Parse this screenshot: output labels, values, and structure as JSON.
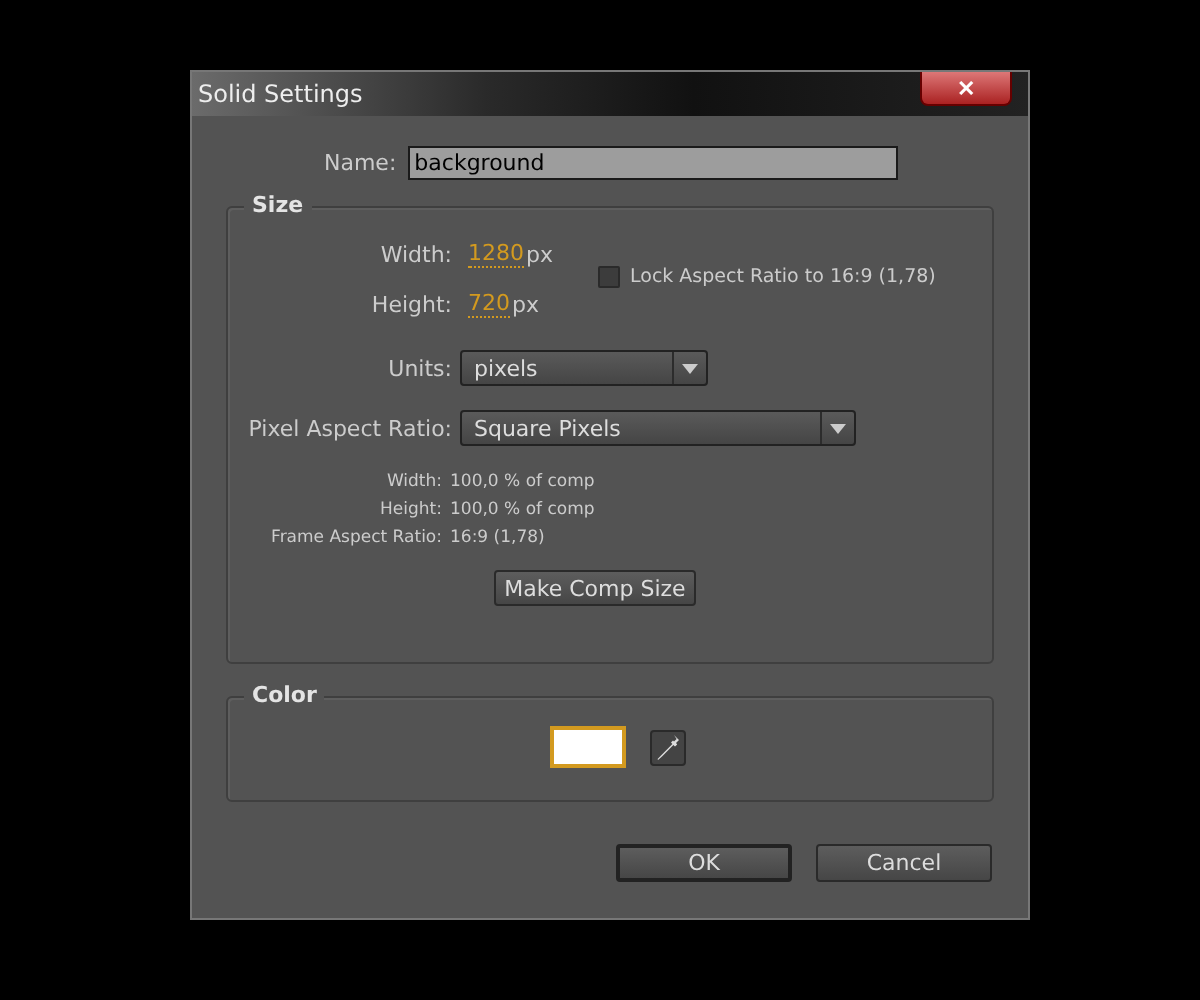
{
  "window": {
    "title": "Solid Settings",
    "close": "✕"
  },
  "name": {
    "label": "Name:",
    "value": "background"
  },
  "size": {
    "title": "Size",
    "width": {
      "label": "Width:",
      "value": "1280",
      "unit": "px"
    },
    "height": {
      "label": "Height:",
      "value": "720",
      "unit": "px"
    },
    "lock": {
      "label": "Lock Aspect Ratio to 16:9 (1,78)",
      "checked": false
    },
    "units": {
      "label": "Units:",
      "value": "pixels"
    },
    "pixel_aspect": {
      "label": "Pixel Aspect Ratio:",
      "value": "Square Pixels"
    },
    "info": [
      {
        "label": "Width:",
        "value": "100,0 % of comp"
      },
      {
        "label": "Height:",
        "value": "100,0 % of comp"
      },
      {
        "label": "Frame Aspect Ratio:",
        "value": "16:9 (1,78)"
      }
    ],
    "make_comp_size": "Make Comp Size"
  },
  "color": {
    "title": "Color",
    "color": "#ffffff"
  },
  "buttons": [
    {
      "label": "OK",
      "default": true
    },
    {
      "label": "Cancel",
      "default": false
    }
  ]
}
